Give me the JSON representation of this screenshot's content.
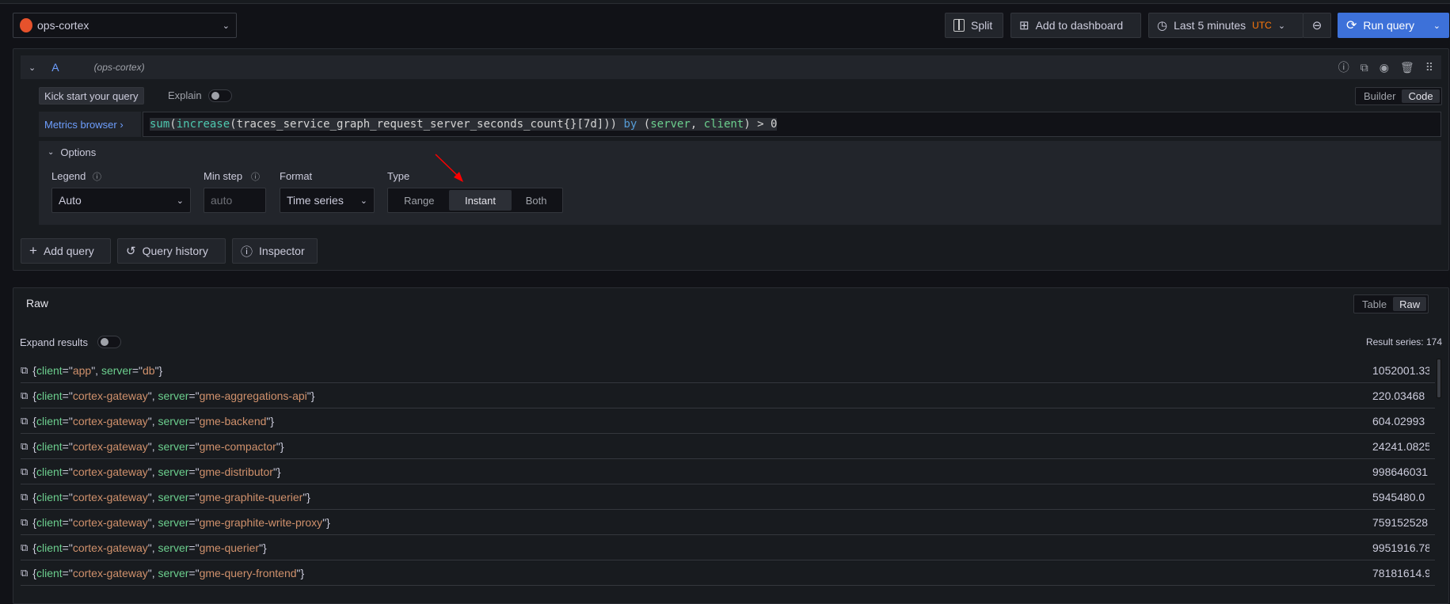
{
  "toolbar": {
    "datasource": "ops-cortex",
    "split_label": "Split",
    "add_to_dashboard_label": "Add to dashboard",
    "time_range": "Last 5 minutes",
    "timezone": "UTC",
    "run_query_label": "Run query",
    "run_query_color": "#3d71d9"
  },
  "query": {
    "ref_id": "A",
    "datasource_hint": "(ops-cortex)",
    "kick_start_label": "Kick start your query",
    "explain_label": "Explain",
    "explain_on": false,
    "mode_builder": "Builder",
    "mode_code": "Code",
    "mode_selected": "Code",
    "metrics_browser_label": "Metrics browser ›",
    "tokens": [
      {
        "text": "sum"
      },
      {
        "text": "("
      },
      {
        "text": "increase"
      },
      {
        "text": "("
      },
      {
        "text": "traces_service_graph_request_server_seconds_count{}[7d]"
      },
      {
        "text": "))"
      },
      {
        "text": " by "
      },
      {
        "text": "("
      },
      {
        "text": "server"
      },
      {
        "text": ", "
      },
      {
        "text": "client"
      },
      {
        "text": ")"
      },
      {
        "text": " > "
      },
      {
        "text": "0"
      }
    ],
    "options": {
      "title": "Options",
      "legend_label": "Legend",
      "legend_value": "Auto",
      "min_step_label": "Min step",
      "min_step_placeholder": "auto",
      "format_label": "Format",
      "format_value": "Time series",
      "type_label": "Type",
      "type_options": [
        "Range",
        "Instant",
        "Both"
      ],
      "type_selected": "Instant"
    }
  },
  "actions": {
    "add_query": "Add query",
    "query_history": "Query history",
    "inspector": "Inspector"
  },
  "results": {
    "title": "Raw",
    "view_table": "Table",
    "view_raw": "Raw",
    "view_selected": "Raw",
    "expand_label": "Expand results",
    "expand_on": false,
    "series_count": "Result series: 174",
    "rows": [
      {
        "client": "app",
        "server": "db",
        "value": "1052001.33"
      },
      {
        "client": "cortex-gateway",
        "server": "gme-aggregations-api",
        "value": "220.03468"
      },
      {
        "client": "cortex-gateway",
        "server": "gme-backend",
        "value": "604.02993"
      },
      {
        "client": "cortex-gateway",
        "server": "gme-compactor",
        "value": "24241.0825"
      },
      {
        "client": "cortex-gateway",
        "server": "gme-distributor",
        "value": "998646031"
      },
      {
        "client": "cortex-gateway",
        "server": "gme-graphite-querier",
        "value": "5945480.0"
      },
      {
        "client": "cortex-gateway",
        "server": "gme-graphite-write-proxy",
        "value": "759152528"
      },
      {
        "client": "cortex-gateway",
        "server": "gme-querier",
        "value": "9951916.78"
      },
      {
        "client": "cortex-gateway",
        "server": "gme-query-frontend",
        "value": "78181614.9"
      }
    ]
  }
}
